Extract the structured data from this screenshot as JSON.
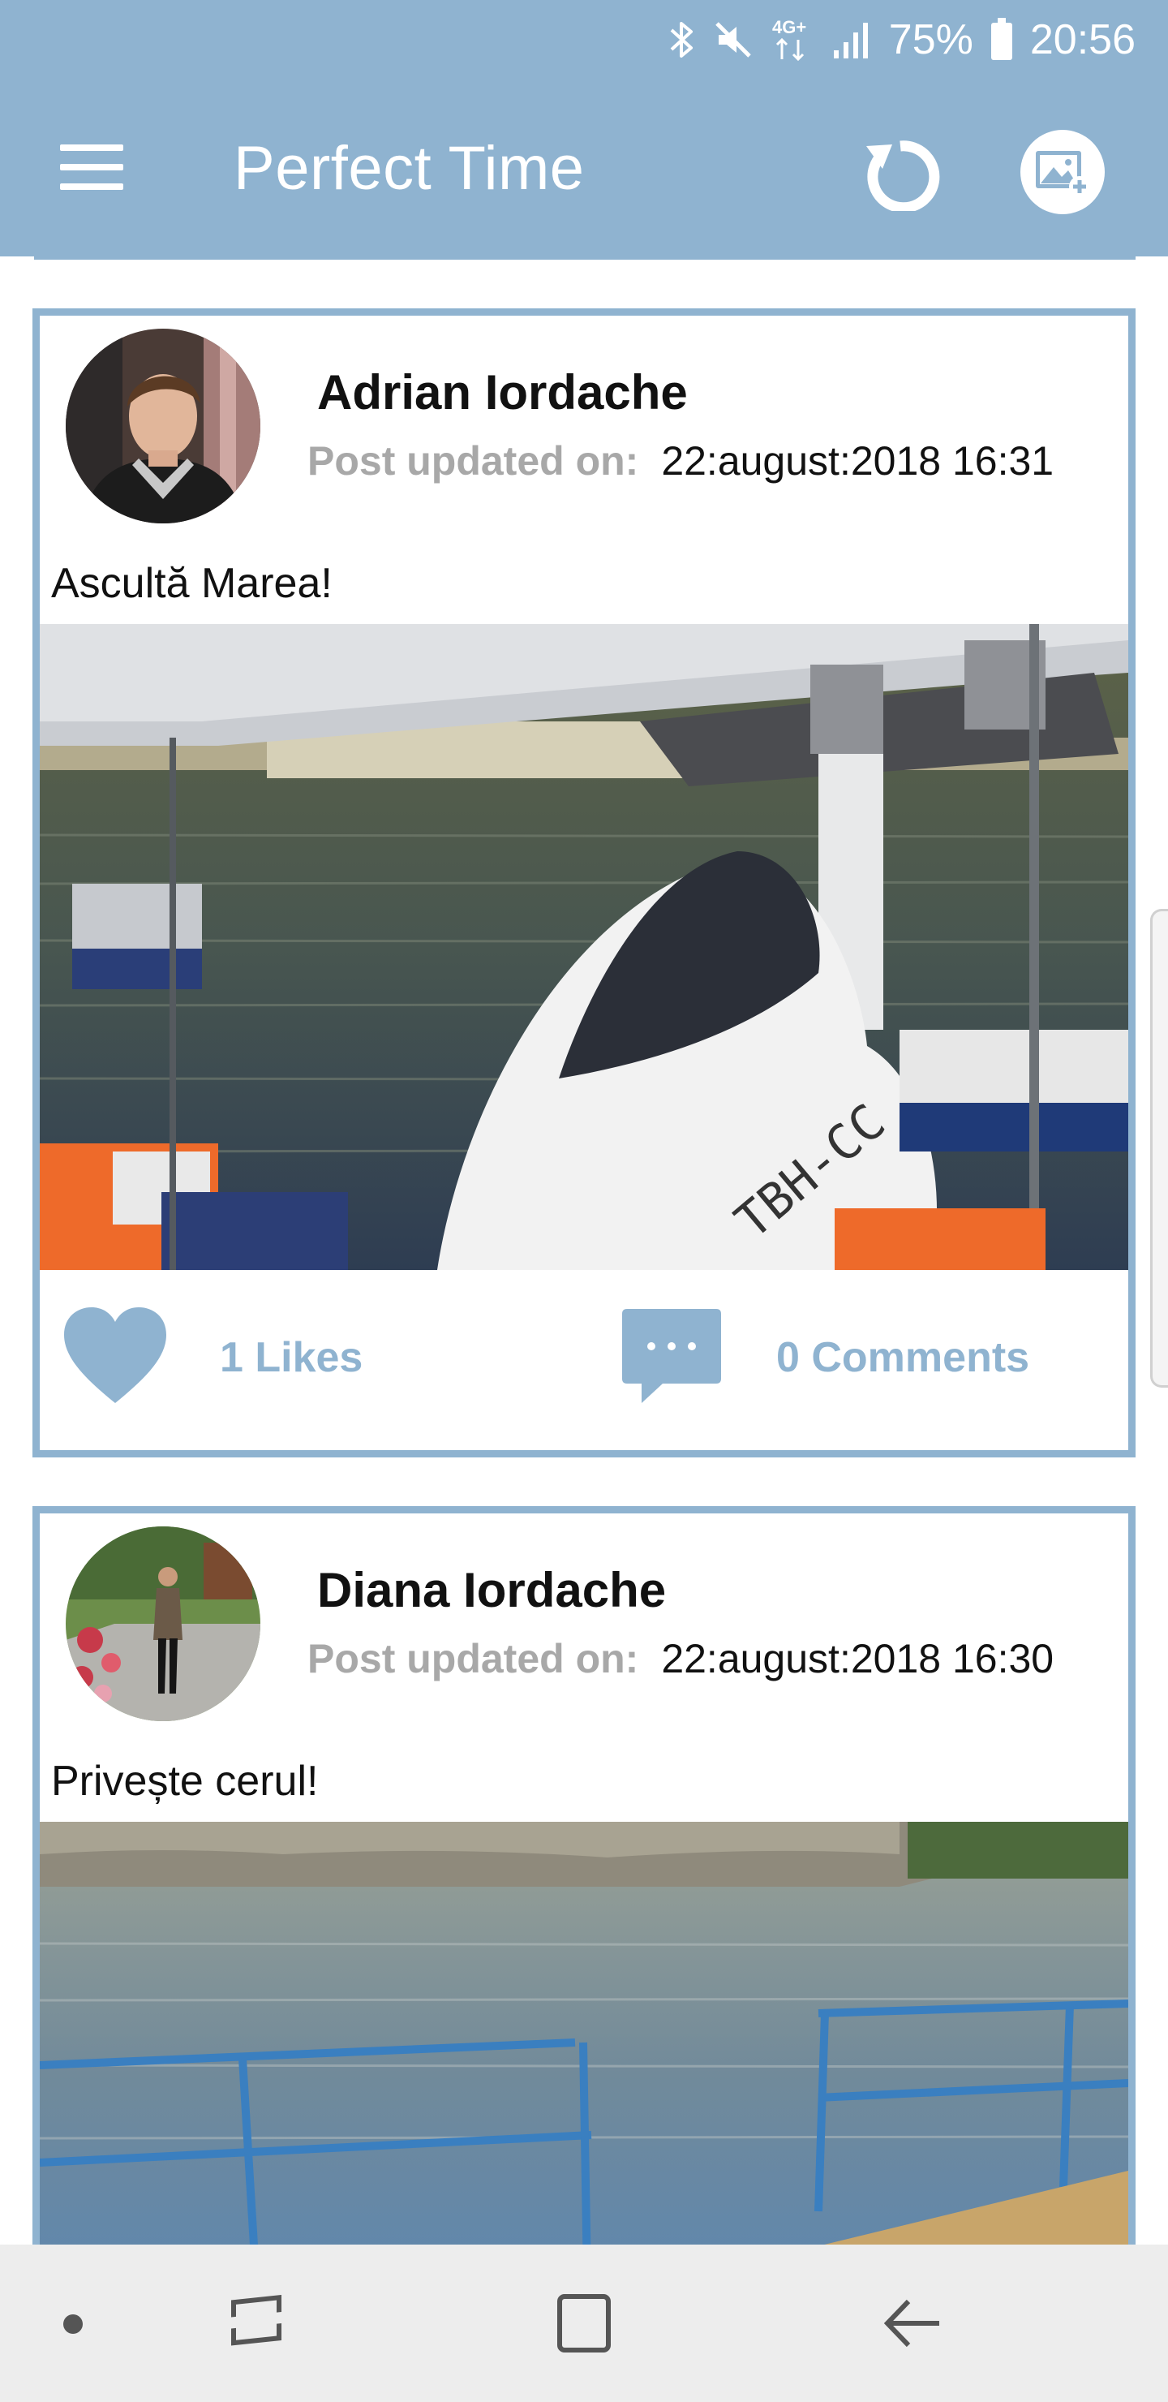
{
  "status_bar": {
    "network": "4G+",
    "battery": "75%",
    "time": "20:56",
    "icons": [
      "bluetooth-icon",
      "mute-icon",
      "network-icon",
      "signal-icon",
      "battery-icon"
    ]
  },
  "app_bar": {
    "title": "Perfect Time",
    "icons": [
      "menu-icon",
      "refresh-icon",
      "add-photo-icon"
    ]
  },
  "posts": [
    {
      "author": "Adrian Iordache",
      "updated_label": "Post updated on:",
      "date": "22:august:2018  16:31",
      "caption": "Ascultă Marea!",
      "likes": "1 Likes",
      "comments": "0 Comments"
    },
    {
      "author": "Diana Iordache",
      "updated_label": "Post updated on:",
      "date": "22:august:2018  16:30",
      "caption": "Privește cerul!"
    }
  ],
  "nav_bar": {
    "icons": [
      "dot-icon",
      "recents-icon",
      "home-icon",
      "back-icon"
    ]
  },
  "colors": {
    "accent": "#8fb3d0",
    "meta_label": "#a8a8a8",
    "text": "#111111",
    "nav_background": "#ededed"
  }
}
